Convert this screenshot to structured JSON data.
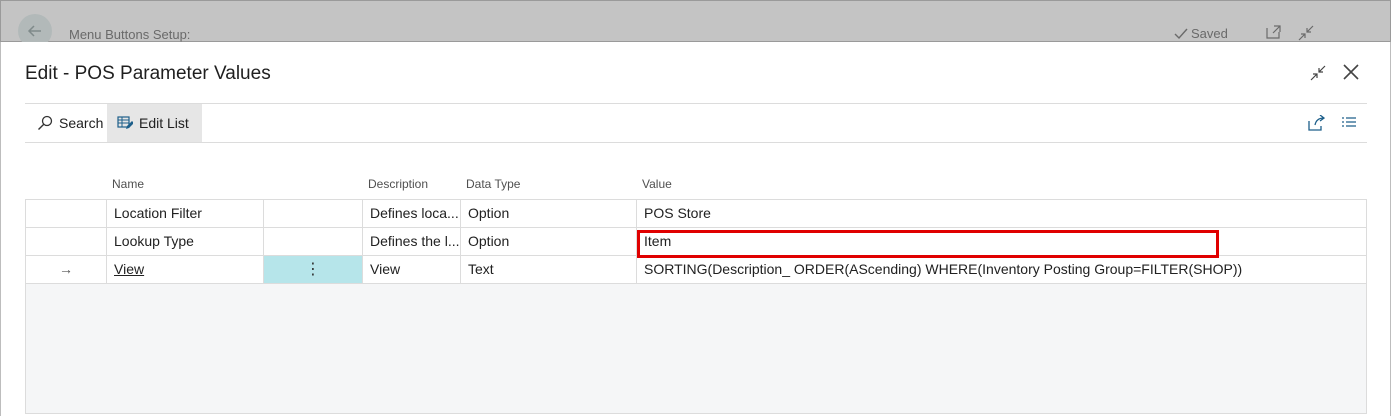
{
  "background": {
    "title": "Menu Buttons Setup:",
    "saved_label": "Saved"
  },
  "dialog": {
    "title": "Edit - POS Parameter Values",
    "toolbar": {
      "search_label": "Search",
      "edit_list_label": "Edit List"
    },
    "columns": [
      "Name",
      "Description",
      "Data Type",
      "Value"
    ],
    "rows": [
      {
        "name": "Location Filter",
        "description": "Defines loca...",
        "data_type": "Option",
        "value": "POS Store"
      },
      {
        "name": "Lookup Type",
        "description": "Defines the l...",
        "data_type": "Option",
        "value": "Item"
      },
      {
        "name": "View",
        "description": "View",
        "data_type": "Text",
        "value": "SORTING(Description_ ORDER(AScending) WHERE(Inventory Posting Group=FILTER(SHOP))"
      }
    ],
    "row_marker": "→",
    "row_menu": "⋮"
  },
  "colors": {
    "selected_cell": "#b6e5ea",
    "highlight_border": "#e00000"
  }
}
